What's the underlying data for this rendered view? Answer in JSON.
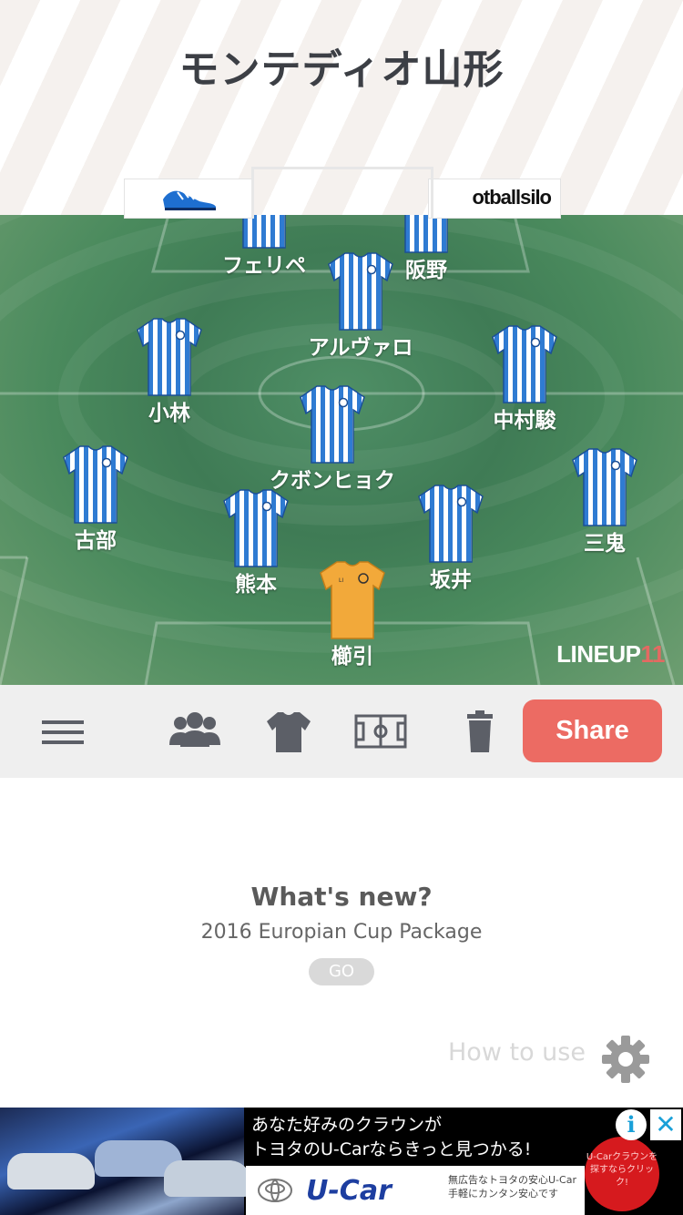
{
  "header": {
    "title": "モンテディオ山形",
    "sponsor_board": "otballsilo"
  },
  "players": [
    {
      "name": "フェリペ",
      "kit": "outfield"
    },
    {
      "name": "阪野",
      "kit": "outfield"
    },
    {
      "name": "アルヴァロ",
      "kit": "outfield"
    },
    {
      "name": "小林",
      "kit": "outfield"
    },
    {
      "name": "中村駿",
      "kit": "outfield"
    },
    {
      "name": "クボンヒョク",
      "kit": "outfield"
    },
    {
      "name": "古部",
      "kit": "outfield"
    },
    {
      "name": "三鬼",
      "kit": "outfield"
    },
    {
      "name": "熊本",
      "kit": "outfield"
    },
    {
      "name": "坂井",
      "kit": "outfield"
    },
    {
      "name": "櫛引",
      "kit": "goalkeeper"
    }
  ],
  "brand": {
    "text": "LINEUP",
    "number": "11"
  },
  "toolbar": {
    "icons": [
      "menu-icon",
      "players-icon",
      "shirt-icon",
      "pitch-icon",
      "trash-icon"
    ],
    "share_label": "Share"
  },
  "whats_new": {
    "title": "What's new?",
    "subtitle": "2016 Europian Cup Package",
    "go_label": "GO"
  },
  "help": {
    "how_to_use": "How to use"
  },
  "ad": {
    "line1": "あなた好みのクラウンが",
    "line2": "トヨタのU-Carならきっと見つかる!",
    "logo": "U-Car",
    "small1": "無広告なトヨタの安心U-Car",
    "small2": "手軽にカンタン安心です",
    "badge": "U-Carクラウンを探すならクリック!",
    "adchoices": "i",
    "close": "✕"
  },
  "colors": {
    "share": "#ec6b63",
    "kit_blue": "#2f7bd2",
    "kit_goalkeeper": "#f2a93a",
    "pitch": "#3f7b55",
    "title": "#3c3f45"
  }
}
